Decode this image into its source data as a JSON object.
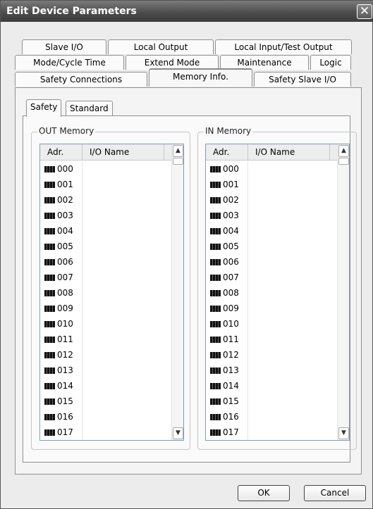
{
  "window": {
    "title": "Edit Device Parameters",
    "close_glyph": "✕"
  },
  "tabs": {
    "row1": [
      "Slave I/O",
      "Local Output",
      "Local Input/Test Output"
    ],
    "row2": [
      "Mode/Cycle Time",
      "Extend Mode",
      "Maintenance",
      "Logic"
    ],
    "row3": [
      "Safety Connections",
      "Memory Info.",
      "Safety Slave I/O"
    ],
    "active": "Memory Info."
  },
  "subtabs": {
    "items": [
      "Safety",
      "Standard"
    ],
    "active": "Safety"
  },
  "out_memory": {
    "label": "OUT Memory",
    "columns": [
      "Adr.",
      "I/O Name"
    ],
    "rows": [
      "000",
      "001",
      "002",
      "003",
      "004",
      "005",
      "006",
      "007",
      "008",
      "009",
      "010",
      "011",
      "012",
      "013",
      "014",
      "015",
      "016",
      "017"
    ]
  },
  "in_memory": {
    "label": "IN Memory",
    "columns": [
      "Adr.",
      "I/O Name"
    ],
    "rows": [
      "000",
      "001",
      "002",
      "003",
      "004",
      "005",
      "006",
      "007",
      "008",
      "009",
      "010",
      "011",
      "012",
      "013",
      "014",
      "015",
      "016",
      "017"
    ]
  },
  "buttons": {
    "ok": "OK",
    "cancel": "Cancel"
  },
  "icons": {
    "close": "close-icon",
    "io_chip": "io-chip-icon",
    "scroll_up": "scroll-up-icon",
    "scroll_down": "scroll-down-icon"
  }
}
